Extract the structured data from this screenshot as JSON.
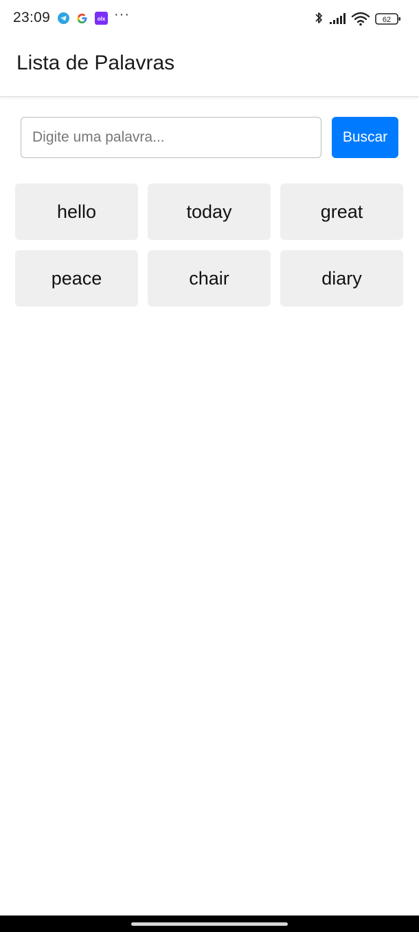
{
  "status_bar": {
    "time": "23:09",
    "more": "···",
    "battery_level": "62",
    "icons": [
      "telegram-icon",
      "google-icon",
      "olx-icon",
      "bluetooth-icon",
      "signal-icon",
      "wifi-icon",
      "battery-icon"
    ],
    "colors": {
      "telegram": "#2ca5e0",
      "olx": "#7b2ff7"
    }
  },
  "app_bar": {
    "title": "Lista de Palavras"
  },
  "search": {
    "placeholder": "Digite uma palavra...",
    "value": "",
    "button_label": "Buscar"
  },
  "words": [
    "hello",
    "today",
    "great",
    "peace",
    "chair",
    "diary"
  ],
  "colors": {
    "accent": "#007bff",
    "card_bg": "#efefef"
  }
}
